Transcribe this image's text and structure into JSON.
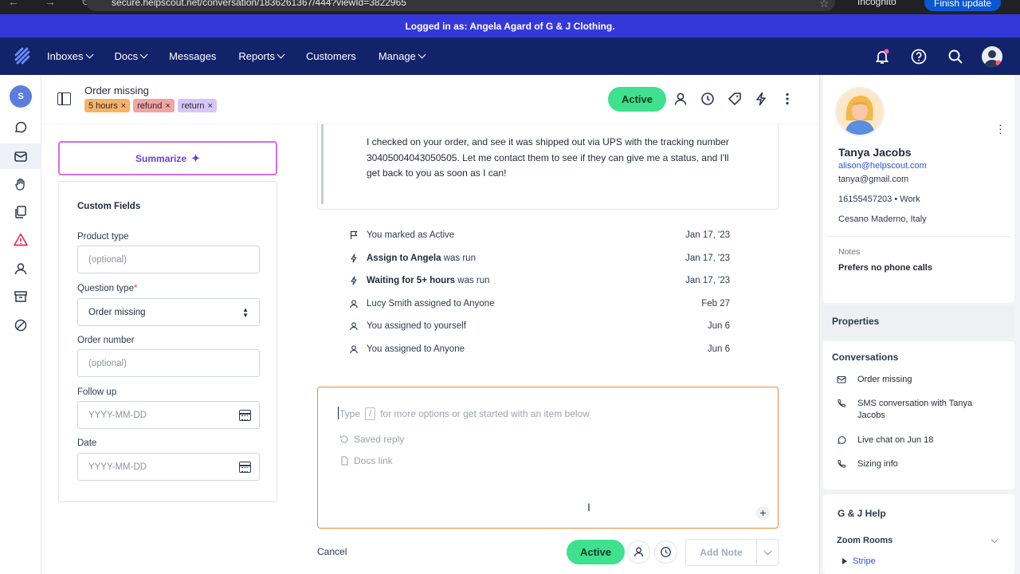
{
  "browser": {
    "url": "secure.helpscout.net/conversation/1836261367/444?viewId=3822965",
    "incognito_label": "Incognito",
    "finish_update_label": "Finish update"
  },
  "banner": {
    "text": "Logged in as: Angela Agard of G & J Clothing."
  },
  "topnav": {
    "items": [
      {
        "label": "Inboxes",
        "has_dropdown": true
      },
      {
        "label": "Docs",
        "has_dropdown": true
      },
      {
        "label": "Messages",
        "has_dropdown": false
      },
      {
        "label": "Reports",
        "has_dropdown": true
      },
      {
        "label": "Customers",
        "has_dropdown": false
      },
      {
        "label": "Manage",
        "has_dropdown": true
      }
    ],
    "icons": [
      "bell-icon",
      "help-icon",
      "search-icon"
    ]
  },
  "rail": {
    "badge": "S"
  },
  "conversation": {
    "subject": "Order missing",
    "tags": [
      {
        "label": "5 hours",
        "color": "#f7b267"
      },
      {
        "label": "refund",
        "color": "#f4a3a3"
      },
      {
        "label": "return",
        "color": "#d6c6f5"
      }
    ],
    "status": "Active"
  },
  "summarize": {
    "label": "Summarize"
  },
  "custom_fields": {
    "title": "Custom Fields",
    "product_type": {
      "label": "Product type",
      "placeholder": "(optional)"
    },
    "question_type": {
      "label": "Question type",
      "required_mark": "*",
      "value": "Order missing"
    },
    "order_number": {
      "label": "Order number",
      "placeholder": "(optional)"
    },
    "follow_up": {
      "label": "Follow up",
      "placeholder": "YYYY-MM-DD"
    },
    "date": {
      "label": "Date",
      "placeholder": "YYYY-MM-DD"
    }
  },
  "message": {
    "body": "I checked on your order, and see it was shipped out via UPS with the tracking number 30405004043050505. Let me contact them to see if they can give me a status, and I'll get back to you as soon as I can!"
  },
  "activity": [
    {
      "icon": "flag-icon",
      "bold": "",
      "text": "You marked as Active",
      "date": "Jan 17, '23"
    },
    {
      "icon": "bolt-icon",
      "bold": "Assign to Angela",
      "text": " was run",
      "date": "Jan 17, '23"
    },
    {
      "icon": "bolt-icon",
      "bold": "Waiting for 5+ hours",
      "text": " was run",
      "date": "Jan 17, '23"
    },
    {
      "icon": "person-icon",
      "bold": "",
      "text": "Lucy Smith assigned to Anyone",
      "date": "Feb 27"
    },
    {
      "icon": "person-icon",
      "bold": "",
      "text": "You assigned to yourself",
      "date": "Jun 6"
    },
    {
      "icon": "person-icon",
      "bold": "",
      "text": "You assigned to Anyone",
      "date": "Jun 6"
    }
  ],
  "editor": {
    "placeholder_pre": "Type",
    "placeholder_slash": "/",
    "placeholder_post": "for more options or get started with an item below",
    "options": [
      "Saved reply",
      "Docs link"
    ]
  },
  "actions": {
    "cancel": "Cancel",
    "status": "Active",
    "add_note": "Add Note"
  },
  "customer": {
    "name": "Tanya Jacobs",
    "email_primary": "alison@helpscout.com",
    "email_secondary": "tanya@gmail.com",
    "phone": "16155457203  •  Work",
    "location": "Cesano Maderno, Italy",
    "notes_label": "Notes",
    "notes_value": "Prefers no phone calls"
  },
  "properties": {
    "title": "Properties"
  },
  "conversations": {
    "title": "Conversations",
    "items": [
      {
        "icon": "mail-icon",
        "label": "Order missing"
      },
      {
        "icon": "phone-icon",
        "label": "SMS conversation with Tanya Jacobs"
      },
      {
        "icon": "chat-icon",
        "label": "Live chat on Jun 18"
      },
      {
        "icon": "phone-icon",
        "label": "Sizing info"
      }
    ]
  },
  "help": {
    "title": "G & J Help",
    "section": "Zoom Rooms",
    "link": "Stripe"
  },
  "colors": {
    "banner": "#3538d9",
    "nav": "#13236a",
    "status_green": "#3fe08e",
    "editor_border": "#f0883a"
  }
}
